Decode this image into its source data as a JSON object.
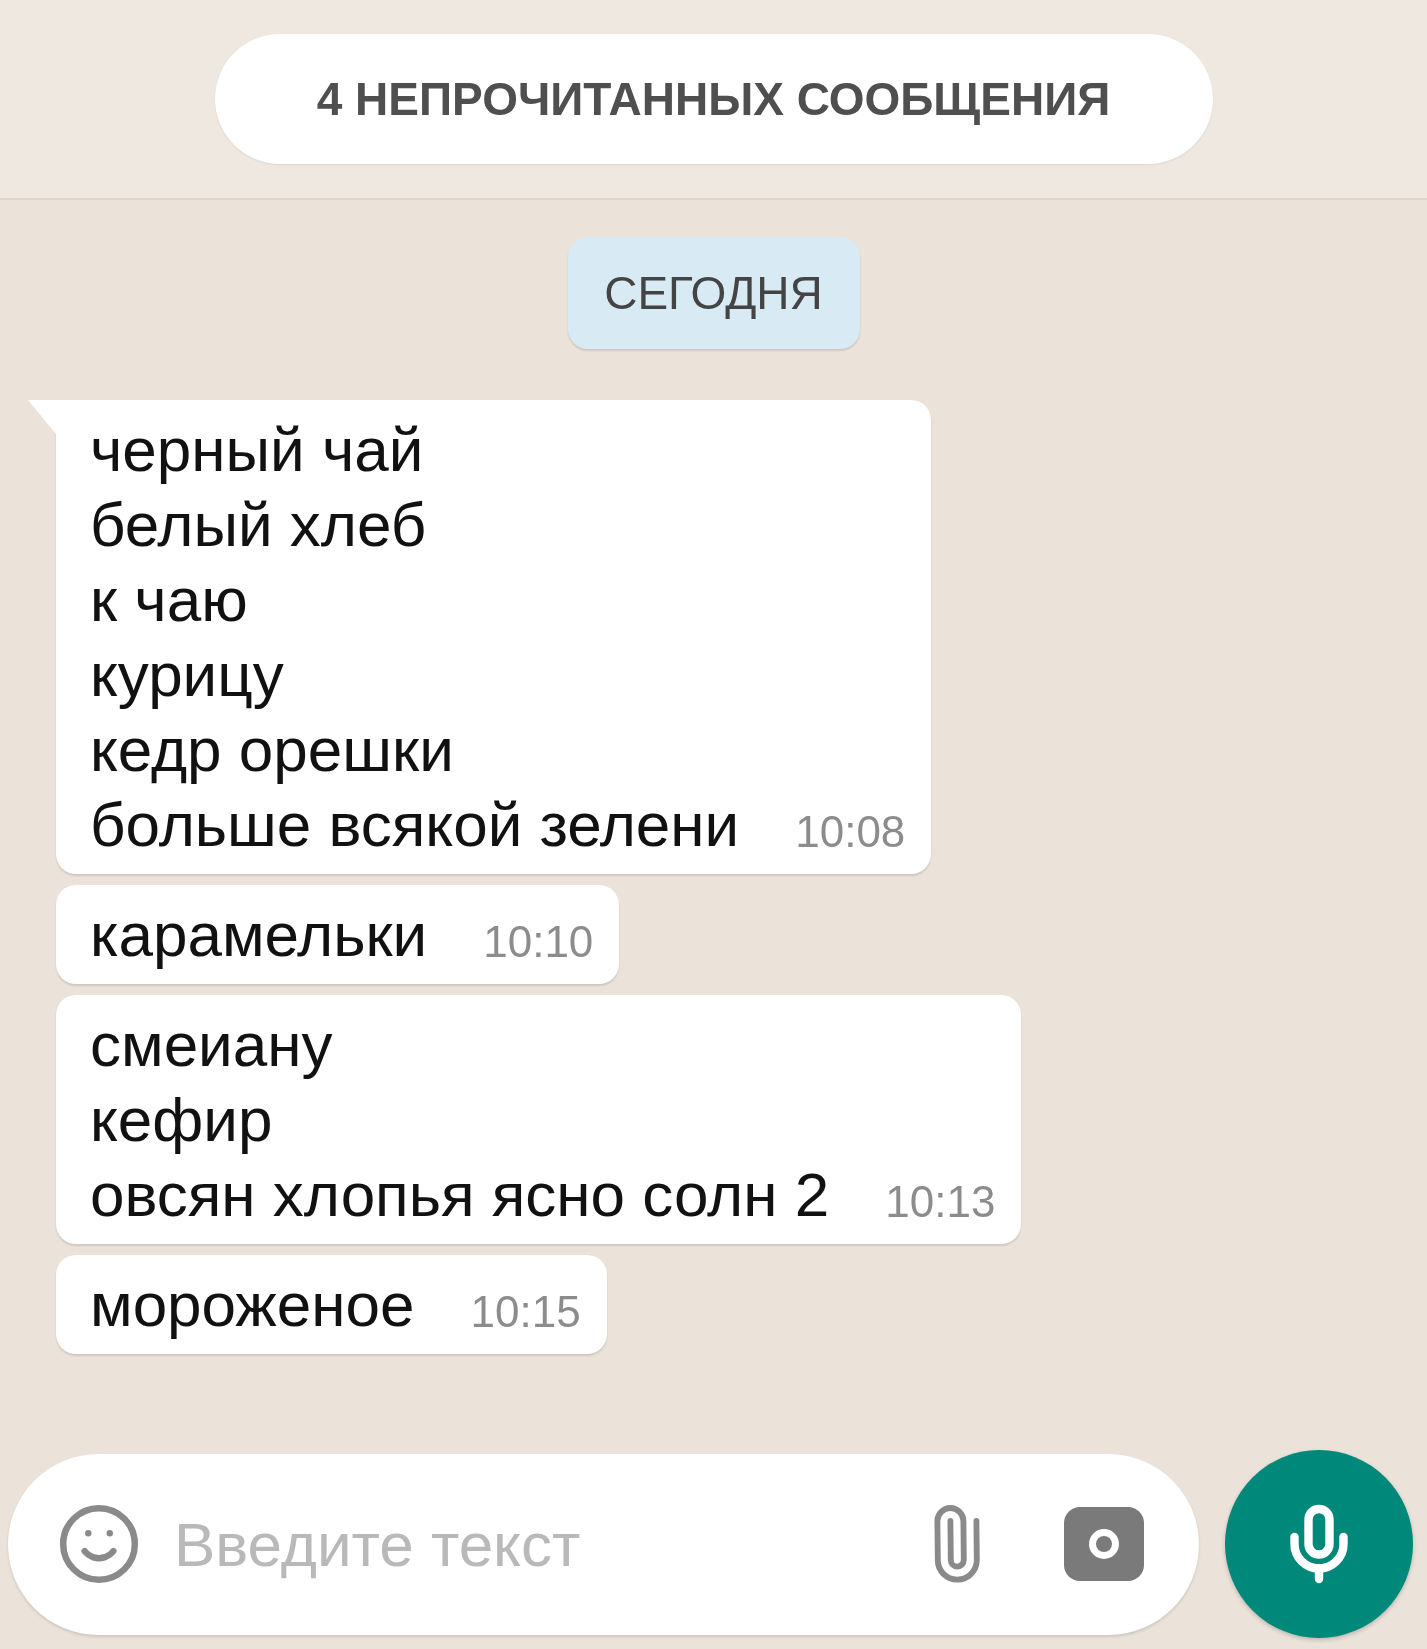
{
  "unread_banner": {
    "text": "4 НЕПРОЧИТАННЫХ СООБЩЕНИЯ"
  },
  "date_chip": {
    "text": "СЕГОДНЯ"
  },
  "messages": [
    {
      "text": "черный чай\nбелый хлеб\nк чаю\nкурицу\nкедр орешки\nбольше всякой зелени",
      "time": "10:08",
      "tail": true
    },
    {
      "text": "карамельки",
      "time": "10:10",
      "tail": false
    },
    {
      "text": "смеиану\nкефир\nовсян хлопья ясно солн 2",
      "time": "10:13",
      "tail": false
    },
    {
      "text": "мороженое",
      "time": "10:15",
      "tail": false
    }
  ],
  "composer": {
    "placeholder": "Введите текст"
  }
}
